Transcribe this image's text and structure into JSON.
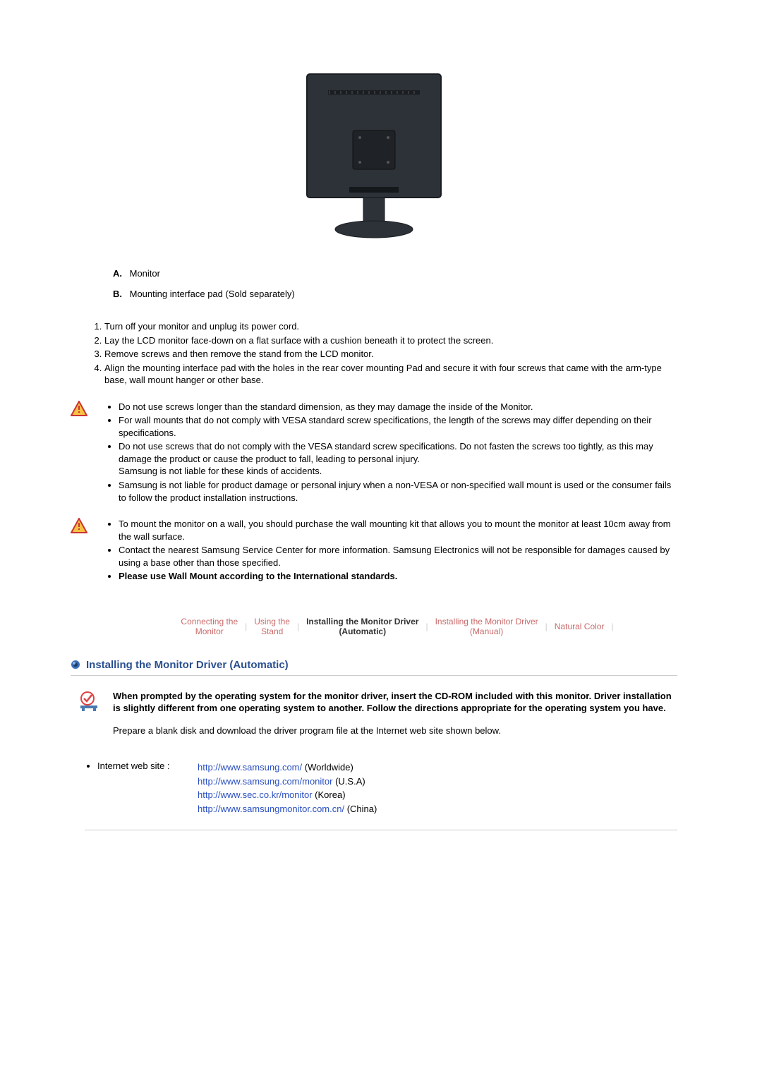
{
  "parts": {
    "a_letter": "A.",
    "a_text": "Monitor",
    "b_letter": "B.",
    "b_text": "Mounting interface pad (Sold separately)"
  },
  "steps": [
    "Turn off your monitor and unplug its power cord.",
    "Lay the LCD monitor face-down on a flat surface with a cushion beneath it to protect the screen.",
    "Remove screws and then remove the stand from the LCD monitor.",
    "Align the mounting interface pad with the holes in the rear cover mounting Pad and secure it with four screws that came with the arm-type base, wall mount hanger or other base."
  ],
  "warn1": [
    "Do not use screws longer than the standard dimension, as they may damage the inside of the Monitor.",
    "For wall mounts that do not comply with VESA standard screw specifications, the length of the screws may differ depending on their specifications.",
    "Do not use screws that do not comply with the VESA standard screw specifications. Do not fasten the screws too tightly, as this may damage the product or cause the product to fall, leading to personal injury.\nSamsung is not liable for these kinds of accidents.",
    "Samsung is not liable for product damage or personal injury when a non-VESA or non-specified wall mount is used or the  consumer fails to follow the product installation instructions."
  ],
  "warn2": [
    "To mount the monitor on a wall, you should purchase the wall mounting kit that allows you to mount the monitor at least 10cm away from the wall surface.",
    "Contact the nearest Samsung Service Center for more information. Samsung Electronics will not be responsible for damages caused by using a base other than those specified."
  ],
  "warn2_bold": "Please use Wall Mount according to the International standards.",
  "nav": {
    "t1a": "Connecting the",
    "t1b": "Monitor",
    "t2a": "Using the",
    "t2b": "Stand",
    "t3a": "Installing the Monitor Driver",
    "t3b": "(Automatic)",
    "t4a": "Installing the Monitor Driver",
    "t4b": "(Manual)",
    "t5": "Natural Color"
  },
  "section_title": "Installing the Monitor Driver (Automatic)",
  "info_bold": "When prompted by the operating system for the monitor driver, insert the CD-ROM included with this monitor. Driver installation is slightly different from one operating system to another. Follow the directions appropriate for the operating system you have.",
  "info_p2": "Prepare a blank disk and download the driver program file at the Internet web site shown below.",
  "web_label": "Internet web site :",
  "links": {
    "l1u": "http://www.samsung.com/",
    "l1t": " (Worldwide)",
    "l2u": "http://www.samsung.com/monitor",
    "l2t": " (U.S.A)",
    "l3u": "http://www.sec.co.kr/monitor",
    "l3t": " (Korea)",
    "l4u": "http://www.samsungmonitor.com.cn/",
    "l4t": " (China)"
  }
}
